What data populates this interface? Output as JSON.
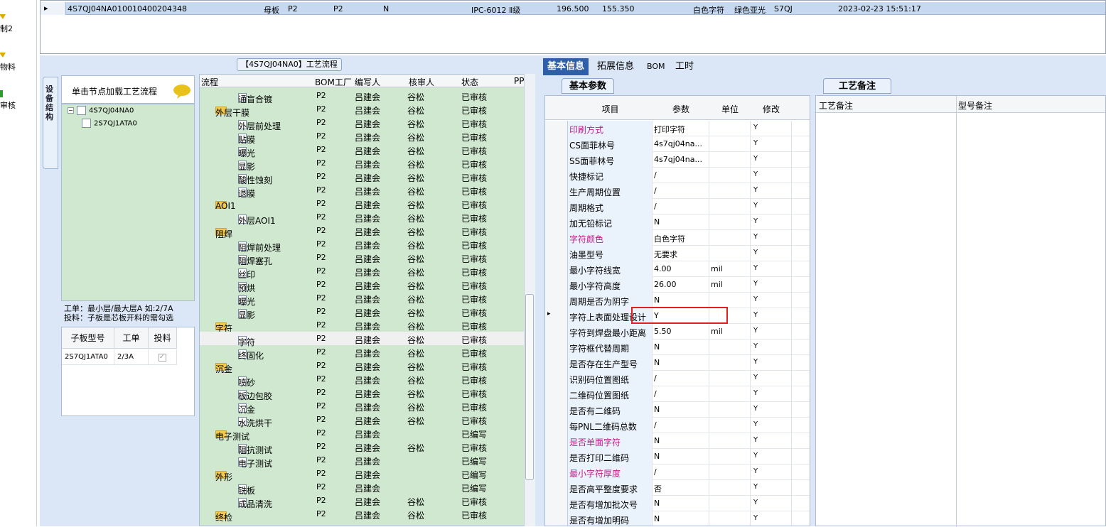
{
  "left_nav": [
    {
      "label": "制2"
    },
    {
      "label": "物料"
    },
    {
      "label": "审核"
    }
  ],
  "top_grid": {
    "cells": [
      "4S7QJ04NA0",
      "10010400204348",
      "母板",
      "P2",
      "P2",
      "N",
      "IPC-6012 Ⅱ级",
      "196.500",
      "155.350",
      "白色字符",
      "绿色亚光",
      "S7QJ",
      "2023-02-23 15:51:17"
    ]
  },
  "side_tab": "设备结构",
  "tree": {
    "header": "单击节点加载工艺流程",
    "nodes": [
      {
        "label": "4S7QJ04NA0",
        "level": 0
      },
      {
        "label": "2S7QJ1ATA0",
        "level": 1
      }
    ]
  },
  "info_text": {
    "line1": "工单：最小层/最大层A 如:2/7A",
    "line2": "投料：子板是芯板开料的需勾选"
  },
  "sub_grid": {
    "headers": [
      "子板型号",
      "工单",
      "投料"
    ],
    "rows": [
      {
        "model": "2S7QJ1ATA0",
        "order": "2/3A",
        "feed": true
      }
    ]
  },
  "flow_title": "【4S7QJ04NA0】工艺流程",
  "process_grid": {
    "headers": [
      "流程",
      "BOM工厂",
      "编写人",
      "核审人",
      "状态",
      "PP"
    ],
    "rows": [
      {
        "name": "通盲合镀",
        "type": "step",
        "bom": "P2",
        "writer": "吕建会",
        "reviewer": "谷松",
        "status": "已审核"
      },
      {
        "name": "外层干膜",
        "type": "group",
        "bom": "P2",
        "writer": "吕建会",
        "reviewer": "谷松",
        "status": "已审核"
      },
      {
        "name": "外层前处理",
        "type": "step",
        "bom": "P2",
        "writer": "吕建会",
        "reviewer": "谷松",
        "status": "已审核"
      },
      {
        "name": "贴膜",
        "type": "step",
        "bom": "P2",
        "writer": "吕建会",
        "reviewer": "谷松",
        "status": "已审核"
      },
      {
        "name": "曝光",
        "type": "step",
        "bom": "P2",
        "writer": "吕建会",
        "reviewer": "谷松",
        "status": "已审核"
      },
      {
        "name": "显影",
        "type": "step",
        "bom": "P2",
        "writer": "吕建会",
        "reviewer": "谷松",
        "status": "已审核"
      },
      {
        "name": "酸性蚀刻",
        "type": "step",
        "bom": "P2",
        "writer": "吕建会",
        "reviewer": "谷松",
        "status": "已审核"
      },
      {
        "name": "退膜",
        "type": "step",
        "bom": "P2",
        "writer": "吕建会",
        "reviewer": "谷松",
        "status": "已审核"
      },
      {
        "name": "AOI1",
        "type": "group",
        "bom": "P2",
        "writer": "吕建会",
        "reviewer": "谷松",
        "status": "已审核"
      },
      {
        "name": "外层AOI1",
        "type": "step",
        "bom": "P2",
        "writer": "吕建会",
        "reviewer": "谷松",
        "status": "已审核"
      },
      {
        "name": "阻焊",
        "type": "group",
        "bom": "P2",
        "writer": "吕建会",
        "reviewer": "谷松",
        "status": "已审核"
      },
      {
        "name": "阻焊前处理",
        "type": "step",
        "bom": "P2",
        "writer": "吕建会",
        "reviewer": "谷松",
        "status": "已审核"
      },
      {
        "name": "阻焊塞孔",
        "type": "step",
        "bom": "P2",
        "writer": "吕建会",
        "reviewer": "谷松",
        "status": "已审核"
      },
      {
        "name": "丝印",
        "type": "step",
        "bom": "P2",
        "writer": "吕建会",
        "reviewer": "谷松",
        "status": "已审核"
      },
      {
        "name": "预烘",
        "type": "step",
        "bom": "P2",
        "writer": "吕建会",
        "reviewer": "谷松",
        "status": "已审核"
      },
      {
        "name": "曝光",
        "type": "step",
        "bom": "P2",
        "writer": "吕建会",
        "reviewer": "谷松",
        "status": "已审核"
      },
      {
        "name": "显影",
        "type": "step",
        "bom": "P2",
        "writer": "吕建会",
        "reviewer": "谷松",
        "status": "已审核"
      },
      {
        "name": "字符",
        "type": "group",
        "bom": "P2",
        "writer": "吕建会",
        "reviewer": "谷松",
        "status": "已审核"
      },
      {
        "name": "字符",
        "type": "step",
        "bom": "P2",
        "writer": "吕建会",
        "reviewer": "谷松",
        "status": "已审核",
        "selected": true
      },
      {
        "name": "终固化",
        "type": "step",
        "bom": "P2",
        "writer": "吕建会",
        "reviewer": "谷松",
        "status": "已审核"
      },
      {
        "name": "沉金",
        "type": "group",
        "bom": "P2",
        "writer": "吕建会",
        "reviewer": "谷松",
        "status": "已审核"
      },
      {
        "name": "喷砂",
        "type": "step",
        "bom": "P2",
        "writer": "吕建会",
        "reviewer": "谷松",
        "status": "已审核"
      },
      {
        "name": "板边包胶",
        "type": "step",
        "bom": "P2",
        "writer": "吕建会",
        "reviewer": "谷松",
        "status": "已审核"
      },
      {
        "name": "沉金",
        "type": "step",
        "bom": "P2",
        "writer": "吕建会",
        "reviewer": "谷松",
        "status": "已审核"
      },
      {
        "name": "水洗烘干",
        "type": "step",
        "bom": "P2",
        "writer": "吕建会",
        "reviewer": "谷松",
        "status": "已审核"
      },
      {
        "name": "电子测试",
        "type": "group",
        "bom": "P2",
        "writer": "吕建会",
        "reviewer": "",
        "status": "已编写"
      },
      {
        "name": "阻抗测试",
        "type": "step",
        "bom": "P2",
        "writer": "吕建会",
        "reviewer": "谷松",
        "status": "已审核"
      },
      {
        "name": "电子测试",
        "type": "step",
        "bom": "P2",
        "writer": "吕建会",
        "reviewer": "",
        "status": "已编写"
      },
      {
        "name": "外形",
        "type": "group",
        "bom": "P2",
        "writer": "吕建会",
        "reviewer": "",
        "status": "已编写"
      },
      {
        "name": "铣板",
        "type": "step",
        "bom": "P2",
        "writer": "吕建会",
        "reviewer": "",
        "status": "已编写"
      },
      {
        "name": "成品清洗",
        "type": "step",
        "bom": "P2",
        "writer": "吕建会",
        "reviewer": "谷松",
        "status": "已审核"
      },
      {
        "name": "终检",
        "type": "group",
        "bom": "P2",
        "writer": "吕建会",
        "reviewer": "谷松",
        "status": "已审核"
      }
    ]
  },
  "right_tabs": [
    "基本信息",
    "拓展信息",
    "BOM",
    "工时"
  ],
  "basic_tab": "基本参数",
  "param_grid": {
    "headers": [
      "项目",
      "参数",
      "单位",
      "修改"
    ],
    "rows": [
      {
        "item": "印刷方式",
        "param": "打印字符",
        "unit": "",
        "mod": "Y",
        "pink": true
      },
      {
        "item": "CS面菲林号",
        "param": "4s7qj04na...",
        "unit": "",
        "mod": "Y"
      },
      {
        "item": "SS面菲林号",
        "param": "4s7qj04na...",
        "unit": "",
        "mod": "Y"
      },
      {
        "item": "快捷标记",
        "param": "/",
        "unit": "",
        "mod": "Y"
      },
      {
        "item": "生产周期位置",
        "param": "/",
        "unit": "",
        "mod": "Y"
      },
      {
        "item": "周期格式",
        "param": "/",
        "unit": "",
        "mod": "Y"
      },
      {
        "item": "加无铅标记",
        "param": "N",
        "unit": "",
        "mod": "Y"
      },
      {
        "item": "字符颜色",
        "param": "白色字符",
        "unit": "",
        "mod": "Y",
        "pink": true
      },
      {
        "item": "油墨型号",
        "param": "无要求",
        "unit": "",
        "mod": "Y"
      },
      {
        "item": "最小字符线宽",
        "param": "4.00",
        "unit": "mil",
        "mod": "Y"
      },
      {
        "item": "最小字符高度",
        "param": "26.00",
        "unit": "mil",
        "mod": "Y"
      },
      {
        "item": "周期是否为阴字",
        "param": "N",
        "unit": "",
        "mod": "Y"
      },
      {
        "item": "字符上表面处理设计",
        "param": "Y",
        "unit": "",
        "mod": "Y",
        "current": true
      },
      {
        "item": "字符到焊盘最小距离",
        "param": "5.50",
        "unit": "mil",
        "mod": "Y"
      },
      {
        "item": "字符框代替周期",
        "param": "N",
        "unit": "",
        "mod": "Y"
      },
      {
        "item": "是否存在生产型号",
        "param": "N",
        "unit": "",
        "mod": "Y"
      },
      {
        "item": "识别码位置图纸",
        "param": "/",
        "unit": "",
        "mod": "Y"
      },
      {
        "item": "二维码位置图纸",
        "param": "/",
        "unit": "",
        "mod": "Y"
      },
      {
        "item": "是否有二维码",
        "param": "N",
        "unit": "",
        "mod": "Y"
      },
      {
        "item": "每PNL二维码总数",
        "param": "/",
        "unit": "",
        "mod": "Y"
      },
      {
        "item": "是否单面字符",
        "param": "N",
        "unit": "",
        "mod": "Y",
        "pink": true
      },
      {
        "item": "是否打印二维码",
        "param": "N",
        "unit": "",
        "mod": "Y"
      },
      {
        "item": "最小字符厚度",
        "param": "/",
        "unit": "",
        "mod": "Y",
        "pink": true
      },
      {
        "item": "是否高平整度要求",
        "param": "否",
        "unit": "",
        "mod": "Y"
      },
      {
        "item": "是否有增加批次号",
        "param": "N",
        "unit": "",
        "mod": "Y"
      },
      {
        "item": "是否有增加明码",
        "param": "N",
        "unit": "",
        "mod": "Y"
      }
    ]
  },
  "remark_tab": "工艺备注",
  "remark_grid": {
    "headers": [
      "工艺备注",
      "型号备注"
    ]
  }
}
